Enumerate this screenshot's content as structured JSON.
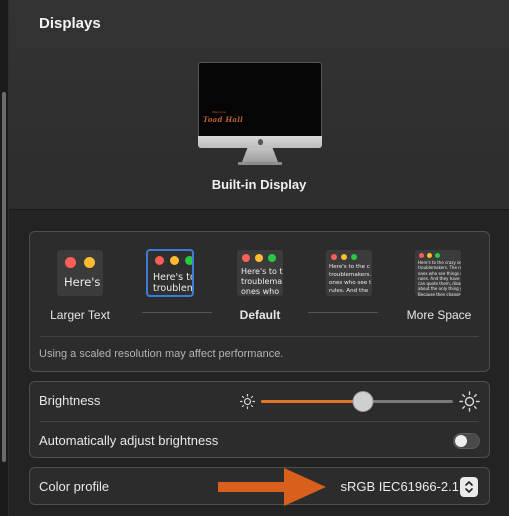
{
  "window": {
    "title": "Displays"
  },
  "display": {
    "name": "Built-in Display",
    "wallpaper_text": "Toad Hall",
    "wallpaper_small_text": "Welcome"
  },
  "resolution": {
    "options": [
      {
        "label": "Larger Text",
        "preview": "Here's",
        "selected": false
      },
      {
        "label": "",
        "preview": "Here's to\ntroublem",
        "selected": true
      },
      {
        "label": "Default",
        "preview": "Here's to t\ntroublema\nones who",
        "selected": false
      },
      {
        "label": "",
        "preview": "Here's to the c\ntroublemakers.\nones who see t\nrules. And the",
        "selected": false
      },
      {
        "label": "More Space",
        "preview": "Here's to the crazy one\ntroublemakers. The rou\nones who see things dif\nrules. And they have no\ncan quote them, disagr\nabout the only thing yo\nBecause they change th",
        "selected": false
      }
    ],
    "note": "Using a scaled resolution may affect performance."
  },
  "brightness": {
    "label": "Brightness",
    "value": 0.53,
    "auto_label": "Automatically adjust brightness",
    "auto_enabled": false
  },
  "color_profile": {
    "label": "Color profile",
    "value": "sRGB IEC61966-2.1"
  },
  "colors": {
    "accent": "#e27425",
    "selected_outline": "#3d7bd9",
    "traffic_red": "#ff5f57",
    "traffic_yellow": "#febc2e",
    "traffic_green": "#28c840",
    "annotation_arrow": "#d9601c"
  },
  "icons": {
    "brightness_low": "sun-small-icon",
    "brightness_high": "sun-large-icon",
    "stepper": "chevron-up-down-icon"
  }
}
